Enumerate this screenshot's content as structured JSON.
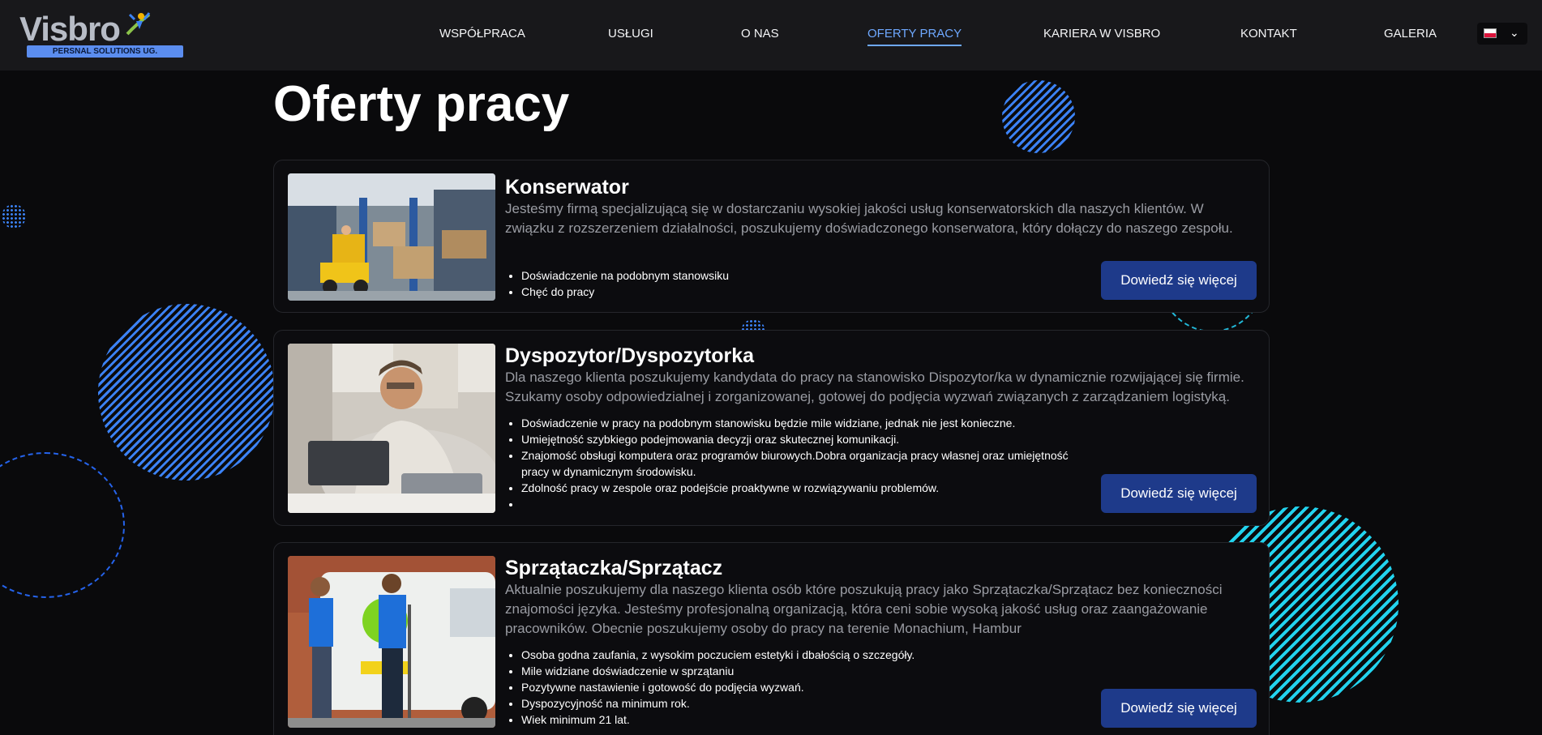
{
  "header": {
    "logo_text": "Visbro",
    "logo_subtitle": "PERSNAL SOLUTIONS UG.",
    "nav": [
      {
        "label": "WSPÓŁPRACA"
      },
      {
        "label": "USŁUGI"
      },
      {
        "label": "O NAS"
      },
      {
        "label": "OFERTY PRACY",
        "active": true
      },
      {
        "label": "KARIERA W VISBRO"
      },
      {
        "label": "KONTAKT"
      },
      {
        "label": "GALERIA"
      }
    ],
    "language": {
      "flag": "flag-pl-icon"
    }
  },
  "page": {
    "title": "Oferty pracy"
  },
  "offers": [
    {
      "title": "Konserwator",
      "description": "Jesteśmy firmą specjalizującą się w dostarczaniu wysokiej jakości usług konserwatorskich dla naszych klientów. W związku z rozszerzeniem działalności, poszukujemy doświadczonego konserwatora, który dołączy do naszego zespołu.",
      "requirements": [
        "Doświadczenie na podobnym stanowsiku",
        "Chęć do pracy"
      ],
      "button": "Dowiedź się więcej",
      "image": "warehouse-forklift-photo"
    },
    {
      "title": "Dyspozytor/Dyspozytorka",
      "description": "Dla naszego klienta poszukujemy kandydata do pracy na stanowisko Dispozytor/ka w dynamicznie rozwijającej się firmie. Szukamy osoby odpowiedzialnej i zorganizowanej, gotowej do podjęcia wyzwań związanych z zarządzaniem logistyką.",
      "requirements": [
        "Doświadczenie w pracy na podobnym stanowisku będzie mile widziane, jednak nie jest konieczne.",
        "Umiejętność szybkiego podejmowania decyzji oraz skutecznej komunikacji.",
        "Znajomość obsługi komputera oraz programów biurowych.Dobra organizacja pracy własnej oraz umiejętność pracy w dynamicznym środowisku.",
        "Zdolność pracy w zespole oraz podejście proaktywne w rozwiązywaniu problemów.",
        ""
      ],
      "button": "Dowiedź się więcej",
      "image": "office-worker-laptop-photo"
    },
    {
      "title": "Sprzątaczka/Sprzątacz",
      "description": "Aktualnie poszukujemy dla naszego klienta osób które poszukują pracy jako Sprzątaczka/Sprzątacz bez konieczności znajomości języka. Jesteśmy profesjonalną organizacją, która ceni sobie wysoką jakość usług oraz zaangażowanie pracowników. Obecnie poszukujemy osoby do pracy na terenie Monachium, Hambur",
      "requirements": [
        "Osoba godna zaufania, z wysokim poczuciem estetyki i dbałością o szczegóły.",
        "Mile widziane doświadczenie w sprzątaniu",
        "Pozytywne nastawienie i gotowość do podjęcia wyzwań.",
        "Dyspozycyjność na minimum rok.",
        "Wiek minimum 21 lat."
      ],
      "button": "Dowiedź się więcej",
      "image": "cleaners-van-photo"
    }
  ]
}
